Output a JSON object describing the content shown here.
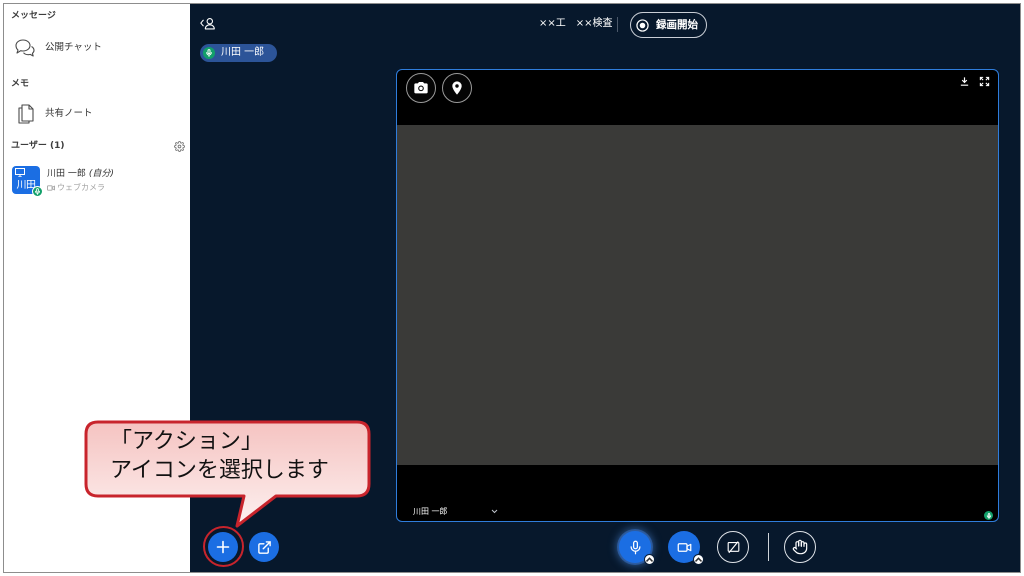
{
  "colors": {
    "main_bg": "#07182c",
    "sidebar_bg": "#ffffff",
    "primary_blue": "#1b6ee3",
    "talking_blue": "#2c5498",
    "mic_green": "#12a06a",
    "video_border": "#2f7ddc",
    "video_feed": "#3a3a38",
    "annotation_red": "#c8242c",
    "callout_fill_top": "#f5c3c1",
    "callout_fill_bottom": "#fdf1f0"
  },
  "sidebar": {
    "messages": {
      "header": "メッセージ",
      "items": [
        {
          "label": "公開チャット",
          "icon": "chat-icon"
        }
      ]
    },
    "notes": {
      "header": "メモ",
      "items": [
        {
          "label": "共有ノート",
          "icon": "shared-notes-icon"
        }
      ]
    },
    "users": {
      "header": "ユーザー (1)",
      "settings_icon": "gear-icon",
      "list": [
        {
          "avatar_text": "川田",
          "name": "川田 一郎",
          "self_tag": "(自分)",
          "status": "ウェブカメラ",
          "status_icon": "webcam-icon"
        }
      ]
    }
  },
  "header": {
    "user_list_toggle_icon": "user-list-toggle-icon",
    "meeting_title": "××工　××検査",
    "record_button": {
      "label": "録画開始",
      "icon": "record-icon"
    }
  },
  "talking_indicator": {
    "name": "川田 一郎",
    "icon": "mic-icon"
  },
  "video": {
    "user_name": "川田 一郎",
    "top_left_buttons": [
      "camera-icon",
      "location-pin-icon"
    ],
    "top_right_buttons": [
      "download-icon",
      "fullscreen-icon"
    ]
  },
  "toolbar": {
    "left": [
      "plus-icon",
      "external-link-icon"
    ],
    "center": [
      "mic-icon",
      "video-camera-icon",
      "screen-share-off-icon",
      "raise-hand-icon"
    ]
  },
  "callout": {
    "line1": "「アクション」",
    "line2": "アイコンを選択します"
  }
}
